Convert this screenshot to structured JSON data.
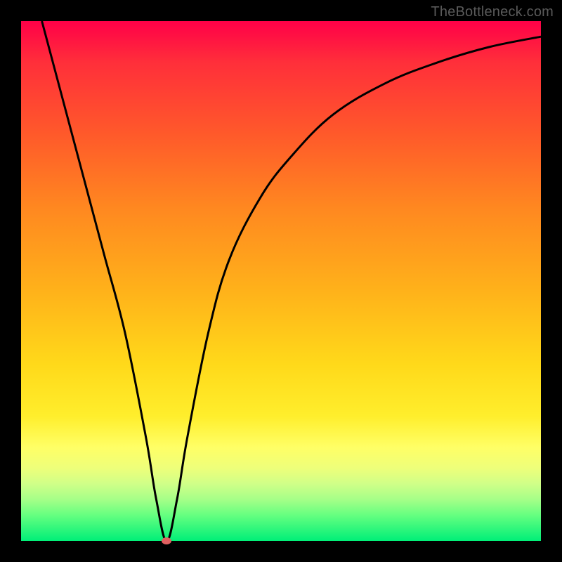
{
  "watermark": {
    "text": "TheBottleneck.com"
  },
  "colors": {
    "curve_stroke": "#000000",
    "marker_fill": "#e06060",
    "frame_bg": "#000000"
  },
  "chart_data": {
    "type": "line",
    "title": "",
    "xlabel": "",
    "ylabel": "",
    "xlim": [
      0,
      100
    ],
    "ylim": [
      0,
      100
    ],
    "grid": false,
    "legend": false,
    "series": [
      {
        "name": "curve",
        "x": [
          4,
          8,
          12,
          16,
          20,
          24,
          26,
          28,
          30,
          32,
          36,
          40,
          46,
          52,
          60,
          70,
          80,
          90,
          100
        ],
        "y": [
          100,
          85,
          70,
          55,
          40,
          20,
          8,
          0,
          8,
          20,
          40,
          54,
          66,
          74,
          82,
          88,
          92,
          95,
          97
        ]
      }
    ],
    "marker": {
      "x": 28,
      "y": 0
    }
  }
}
